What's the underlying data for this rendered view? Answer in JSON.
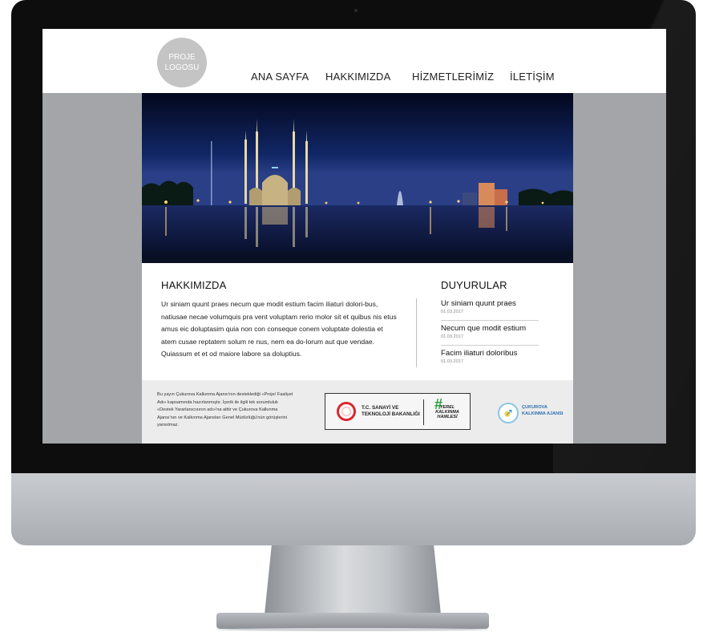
{
  "header": {
    "logo_text": [
      "PROJE",
      "LOGOSU"
    ],
    "nav": [
      "ANA SAYFA",
      "HAKKIMIZDA",
      "HİZMETLERİMİZ",
      "İLETİŞİM"
    ]
  },
  "about": {
    "title": "HAKKIMIZDA",
    "text": "Ur siniam quunt praes necum que modit estium facim iliaturi dolori-bus, natiusae necae volumquis pra vent voluptam rerio molor sit et quibus nis etus amus eic doluptasim quia non con conseque conem voluptate dolestia et atem cusae reptatem solum re nus, nem ea do-lorum aut que vendae. Quiassum et et od maiore labore sa doluptius."
  },
  "announcements": {
    "title": "DUYURULAR",
    "items": [
      {
        "title": "Ur siniam quunt praes",
        "date": "01.03.2017"
      },
      {
        "title": "Necum que modit estium",
        "date": "01.03.2017"
      },
      {
        "title": "Facim iliaturi doloribus",
        "date": "01.03.2017"
      }
    ]
  },
  "footer": {
    "disclaimer": "Bu yayın Çukurova Kalkınma Ajansı'nın desteklediği «Proje/ Faaliyet Adı» kapsamında hazırlanmıştır. İçerik ile ilgili tek sorumluluk «Destek Yararlanıcısının adı»'na aittir ve Çukurova Kalkınma Ajansı'nın ve Kalkınma Ajansları Genel Müdürlüğü'nün görüşlerini yansıtmaz.",
    "ministry": [
      "T.C. SANAYİ VE",
      "TEKNOLOJİ BAKANLIĞI"
    ],
    "hashtag": "#",
    "campaign": [
      "YEREL",
      "KALKINMA",
      "HAMLESİ"
    ],
    "agency": [
      "ÇUKUROVA",
      "KALKINMA AJANSI"
    ]
  },
  "colors": {
    "bezel": "#0d0d0d",
    "screen_bg": "#a3a5a8",
    "logo_circle": "#c4c4c4",
    "footer_bg": "#ececec",
    "hashtag_green": "#2a9d3b",
    "agency_blue": "#2b6fb3",
    "ministry_red": "#d8262e"
  }
}
